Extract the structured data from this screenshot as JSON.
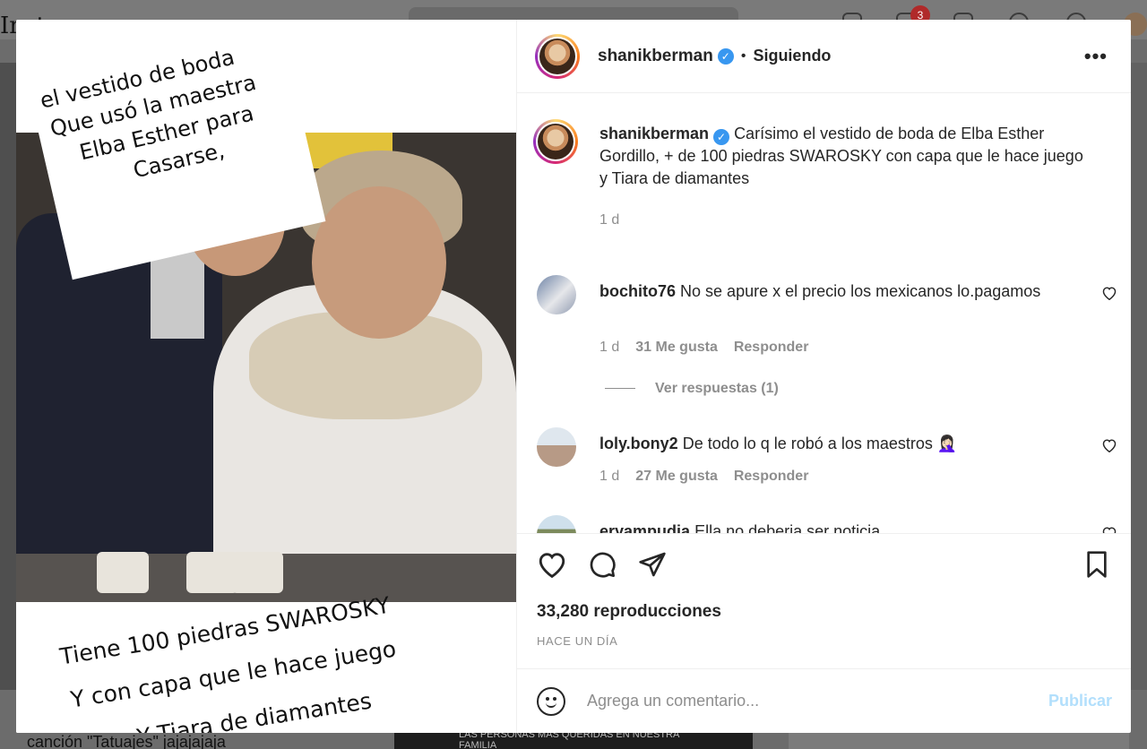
{
  "background": {
    "logo": "Inst",
    "notification_count": "3",
    "bottom_caption": "canción \"Tatuajes\" jajajajaja",
    "bottom_card_text": "LAS PERSONAS MÁS QUERIDAS EN NUESTRA FAMILIA"
  },
  "media": {
    "overlay_top": [
      "el vestido de boda",
      "Que usó la maestra",
      "Elba Esther para",
      "Casarse,"
    ],
    "overlay_bottom": [
      "Tiene 100 piedras SWAROSKY",
      "Y con capa que le hace juego",
      "Y Tiara de diamantes"
    ]
  },
  "header": {
    "username": "shanikberman",
    "verified_icon": "✓",
    "separator": "•",
    "follow_status": "Siguiendo",
    "more_label": "•••"
  },
  "caption": {
    "username": "shanikberman",
    "text": "Carísimo el vestido de boda de Elba Esther Gordillo, + de 100 piedras SWAROSKY con capa que le hace juego y Tiara de diamantes",
    "time": "1 d"
  },
  "comments": [
    {
      "username": "bochito76",
      "text": "No se apure x el precio los mexicanos lo.pagamos",
      "time": "1 d",
      "likes": "31 Me gusta",
      "reply": "Responder"
    },
    {
      "username": "loly.bony2",
      "text": "De todo lo q le robó a los maestros 🤦🏻‍♀️",
      "time": "1 d",
      "likes": "27 Me gusta",
      "reply": "Responder"
    },
    {
      "username": "eryampudia",
      "text": "Ella no deberia ser noticia"
    }
  ],
  "view_replies": "Ver respuestas (1)",
  "stats": {
    "views": "33,280 reproducciones",
    "posted": "HACE UN DÍA"
  },
  "add_comment": {
    "placeholder": "Agrega un comentario...",
    "publish": "Publicar"
  },
  "colors": {
    "verified": "#3897f0",
    "publish_disabled": "#b2dffc",
    "muted_text": "#8e8e8e"
  }
}
